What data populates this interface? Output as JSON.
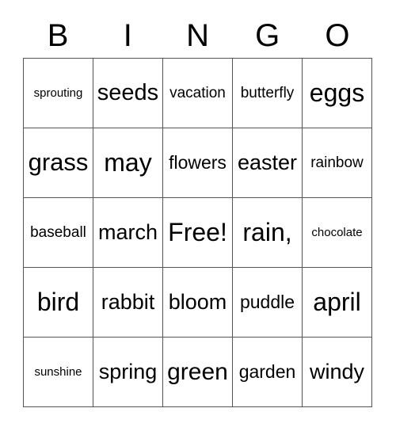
{
  "card": {
    "title": "BINGO",
    "free_space_label": "Free!",
    "border_color": "#555555",
    "text_color": "#000000",
    "background_color": "#ffffff"
  },
  "header": {
    "letters": [
      "B",
      "I",
      "N",
      "G",
      "O"
    ]
  },
  "grid": {
    "columns": 5,
    "rows": 5,
    "cells": [
      [
        {
          "text": "sprouting",
          "size": "xs"
        },
        {
          "text": "seeds",
          "size": "xl"
        },
        {
          "text": "vacation",
          "size": "sm"
        },
        {
          "text": "butterfly",
          "size": "sm"
        },
        {
          "text": "eggs",
          "size": "xl"
        }
      ],
      [
        {
          "text": "grass",
          "size": "xl"
        },
        {
          "text": "may",
          "size": "xl"
        },
        {
          "text": "flowers",
          "size": "md"
        },
        {
          "text": "easter",
          "size": "lg"
        },
        {
          "text": "rainbow",
          "size": "sm"
        }
      ],
      [
        {
          "text": "baseball",
          "size": "sm"
        },
        {
          "text": "march",
          "size": "lg"
        },
        {
          "text": "Free!",
          "size": "xl"
        },
        {
          "text": "rain,",
          "size": "xl"
        },
        {
          "text": "chocolate",
          "size": "xs"
        }
      ],
      [
        {
          "text": "bird",
          "size": "xl"
        },
        {
          "text": "rabbit",
          "size": "lg"
        },
        {
          "text": "bloom",
          "size": "lg"
        },
        {
          "text": "puddle",
          "size": "md"
        },
        {
          "text": "april",
          "size": "xl"
        }
      ],
      [
        {
          "text": "sunshine",
          "size": "xs"
        },
        {
          "text": "spring",
          "size": "lg"
        },
        {
          "text": "green",
          "size": "xl"
        },
        {
          "text": "garden",
          "size": "md"
        },
        {
          "text": "windy",
          "size": "lg"
        }
      ]
    ]
  }
}
